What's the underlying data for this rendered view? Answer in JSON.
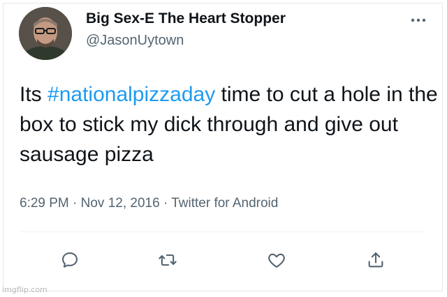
{
  "tweet": {
    "display_name": "Big Sex-E The Heart Stopper",
    "handle": "@JasonUytown",
    "text_prefix": "Its ",
    "hashtag": "#nationalpizzaday",
    "text_suffix": " time to cut a hole in the box to stick my dick through and give out sausage pizza",
    "meta": "6:29 PM · Nov 12, 2016 · Twitter for Android"
  },
  "actions": [
    {
      "icon": "reply-icon"
    },
    {
      "icon": "retweet-icon"
    },
    {
      "icon": "like-icon"
    },
    {
      "icon": "share-icon"
    }
  ],
  "watermark": "imgflip.com",
  "colors": {
    "hashtag": "#1d9bf0",
    "text": "#0f1419",
    "secondary": "#536471"
  }
}
